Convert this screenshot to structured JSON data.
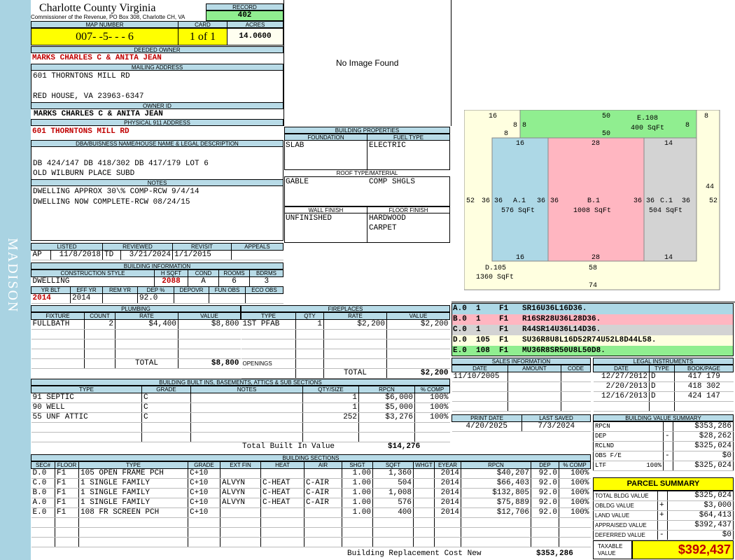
{
  "sidebar": {
    "label": "MADISON"
  },
  "header": {
    "county": "Charlotte County Virginia",
    "office": "Commissioner of the Revenue, PO Box 308, Charlotte CH, VA",
    "record_label": "RECORD",
    "record": "402",
    "map_label": "MAP NUMBER",
    "map": "007- -5- - - 6",
    "card_label": "CARD",
    "card": "1 of 1",
    "acres_label": "ACRES",
    "acres": "14.0600"
  },
  "owner": {
    "deeded_label": "DEEDED OWNER",
    "deeded": "MARKS CHARLES C & ANITA JEAN",
    "mailing_label": "MAILING ADDRESS",
    "mail1": "601 THORNTONS MILL RD",
    "mail2": "RED HOUSE, VA 23963-6347",
    "ownerid_label": "OWNER ID",
    "ownerid": "MARKS CHARLES C & ANITA JEAN",
    "phys_label": "PHYSICAL 911 ADDRESS",
    "phys": "601 THORNTONS MILL RD"
  },
  "legal": {
    "label": "DBA/BUISNESS NAME/HOUSE NAME & LEGAL DESCRIPTION",
    "line1": "DB 424/147 DB 418/302 DB 417/179 LOT 6",
    "line2": "OLD WILBURN PLACE SUBD"
  },
  "notes": {
    "label": "NOTES",
    "line1": "DWELLING APPROX 30\\% COMP-RCW 9/4/14",
    "line2": "DWELLING NOW COMPLETE-RCW 08/24/15"
  },
  "image": {
    "text": "No Image Found"
  },
  "props": {
    "label": "BUILDING PROPERTIES",
    "foundation_label": "FOUNDATION",
    "foundation": "SLAB",
    "fuel_label": "FUEL TYPE",
    "fuel": "ELECTRIC",
    "roof_label": "ROOF TYPE/MATERIAL",
    "roof1": "GABLE",
    "roof2": "COMP SHGLS",
    "wall_label": "WALL FINISH",
    "wall": "UNFINISHED",
    "floor_label": "FLOOR FINISH",
    "floor1": "HARDWOOD",
    "floor2": "CARPET"
  },
  "dates": {
    "listed_label": "LISTED",
    "listed_a": "AP",
    "listed": "11/8/2018",
    "reviewed_label": "REVIEWED",
    "reviewed_a": "TD",
    "reviewed": "3/21/2024",
    "revisit_label": "REVISIT",
    "revisit": "1/1/2015",
    "appeals_label": "APPEALS"
  },
  "bldg": {
    "label": "BUILDING INFORMATION",
    "style_label": "CONSTRUCTION STYLE",
    "hsqft_label": "H SQFT",
    "cond_label": "COND",
    "rooms_label": "ROOMS",
    "bdrms_label": "BDRMS",
    "style": "DWELLING",
    "hsqft": "2088",
    "cond": "A",
    "rooms": "6",
    "bdrms": "3",
    "yrblt_label": "YR BLT",
    "effyr_label": "EFF YR",
    "remyr_label": "REM YR",
    "dep_label": "DEP %",
    "depovr_label": "DEPOVR",
    "funobs_label": "FUN OBS",
    "ecoobs_label": "ECO OBS",
    "yrblt": "2014",
    "effyr": "2014",
    "dep": "92.0"
  },
  "plumbing": {
    "label": "PLUMBING",
    "cols": [
      "FIXTURE",
      "COUNT",
      "RATE",
      "VALUE"
    ],
    "rows": [
      [
        "FULLBATH",
        "2",
        "$4,400",
        "$8,800"
      ]
    ],
    "total_label": "TOTAL",
    "total": "$8,800"
  },
  "fireplaces": {
    "label": "FIREPLACES",
    "cols": [
      "TYPE",
      "QTY",
      "RATE",
      "VALUE"
    ],
    "rows": [
      [
        "1ST PFAB",
        "1",
        "$2,200",
        "$2,200"
      ]
    ],
    "openings_label": "OPENINGS",
    "total_label": "TOTAL",
    "total": "$2,200"
  },
  "builtins": {
    "label": "BUILDING BUILT INS, BASEMENTS, ATTICS & SUB SECTIONS",
    "cols": [
      "TYPE",
      "GRADE",
      "NOTES",
      "QTY/SIZE",
      "RPCN",
      "% COMP"
    ],
    "rows": [
      [
        "91 SEPTIC",
        "C",
        "",
        "1",
        "$6,000",
        "100%"
      ],
      [
        "90 WELL",
        "C",
        "",
        "1",
        "$5,000",
        "100%"
      ],
      [
        "55 UNF ATTIC",
        "C",
        "",
        "252",
        "$3,276",
        "100%"
      ]
    ],
    "total_label": "Total Built In Value",
    "total": "$14,276"
  },
  "sections": {
    "label": "BUILDING SECTIONS",
    "cols": [
      "SEC#",
      "FLOOR",
      "TYPE",
      "GRADE",
      "EXT FIN",
      "HEAT",
      "AIR",
      "SHGT",
      "SQFT",
      "WHGT",
      "EYEAR",
      "RPCN",
      "DEP",
      "% COMP"
    ],
    "rows": [
      [
        "D.0",
        "F1",
        "105 OPEN FRAME PCH",
        "C+10",
        "",
        "",
        "",
        "1.00",
        "1,360",
        "",
        "2014",
        "$40,207",
        "92.0",
        "100%"
      ],
      [
        "C.0",
        "F1",
        "1 SINGLE FAMILY",
        "C+10",
        "ALVYN",
        "C-HEAT",
        "C-AIR",
        "1.00",
        "504",
        "",
        "2014",
        "$66,403",
        "92.0",
        "100%"
      ],
      [
        "B.0",
        "F1",
        "1 SINGLE FAMILY",
        "C+10",
        "ALVYN",
        "C-HEAT",
        "C-AIR",
        "1.00",
        "1,008",
        "",
        "2014",
        "$132,805",
        "92.0",
        "100%"
      ],
      [
        "A.0",
        "F1",
        "1 SINGLE FAMILY",
        "C+10",
        "ALVYN",
        "C-HEAT",
        "C-AIR",
        "1.00",
        "576",
        "",
        "2014",
        "$75,889",
        "92.0",
        "100%"
      ],
      [
        "E.0",
        "F1",
        "108 FR SCREEN PCH",
        "C+10",
        "",
        "",
        "",
        "1.00",
        "400",
        "",
        "2014",
        "$12,706",
        "92.0",
        "100%"
      ]
    ],
    "total_label": "Building Replacement Cost New",
    "total": "$353,286"
  },
  "sketch_legend": [
    {
      "text": "A.0  1    F1   SR16U36L16D36.",
      "color": "#add8e6"
    },
    {
      "text": "B.0  1    F1   R16SR28U36L28D36.",
      "color": "#ffb6c1"
    },
    {
      "text": "C.0  1    F1   R44SR14U36L14D36.",
      "color": "#d3d3d3"
    },
    {
      "text": "D.0  105  F1   SU36R8U8L16D52R74U52L8D44L58.",
      "color": "#ffffe0"
    },
    {
      "text": "E.0  108  F1   MU36R8SR50U8L50D8.",
      "color": "#90ee90"
    }
  ],
  "sketch": {
    "labels": {
      "e_name": "E.108",
      "e_area": "400 SqFt",
      "a_name": "A.1",
      "a_area": "576 SqFt",
      "b_name": "B.1",
      "b_area": "1008 SqFt",
      "c_name": "C.1",
      "c_area": "504 SqFt",
      "d_name": "D.105",
      "d_area": "1360 SqFt"
    },
    "dims": {
      "d16": "16",
      "d50": "50",
      "d8": "8",
      "d28": "28",
      "d14": "14",
      "d36": "36",
      "d52": "52",
      "d44": "44",
      "d58": "58",
      "d74": "74"
    }
  },
  "sales": {
    "label": "SALES INFORMATION",
    "cols": [
      "DATE",
      "AMOUNT",
      "CODE"
    ],
    "rows": [
      [
        "11/10/2005",
        "",
        ""
      ]
    ]
  },
  "legal_inst": {
    "label": "LEGAL INSTRUMENTS",
    "cols": [
      "DATE",
      "TYPE",
      "BOOK/PAGE"
    ],
    "rows": [
      [
        "12/27/2012",
        "D",
        "417 179"
      ],
      [
        "2/20/2013",
        "D",
        "418 302"
      ],
      [
        "12/16/2013",
        "D",
        "424 147"
      ]
    ]
  },
  "print": {
    "print_label": "PRINT DATE",
    "print": "4/20/2025",
    "saved_label": "LAST SAVED",
    "saved": "7/3/2024"
  },
  "bvs": {
    "label": "BUILDING VALUE SUMMARY",
    "rows": [
      {
        "k": "RPCN",
        "s": "",
        "v": "$353,286"
      },
      {
        "k": "DEP",
        "s": "-",
        "v": "$28,262"
      },
      {
        "k": "RCLND",
        "s": "",
        "v": "$325,024"
      },
      {
        "k": "OBS F/E",
        "s": "-",
        "v": "$0"
      },
      {
        "k": "LTF",
        "p": "100%",
        "s": "",
        "v": "$325,024"
      }
    ]
  },
  "parcel": {
    "label": "PARCEL SUMMARY",
    "rows": [
      {
        "k": "TOTAL BLDG VALUE",
        "s": "",
        "v": "$325,024"
      },
      {
        "k": "OBLDG VALUE",
        "s": "+",
        "v": "$3,000"
      },
      {
        "k": "LAND VALUE",
        "s": "+",
        "v": "$64,413"
      },
      {
        "k": "APPRAISED VALUE",
        "s": "",
        "v": "$392,437"
      },
      {
        "k": "DEFERRED VALUE",
        "s": "-",
        "v": "$0"
      }
    ],
    "taxable_label": "TAXABLE VALUE",
    "taxable": "$392,437"
  }
}
